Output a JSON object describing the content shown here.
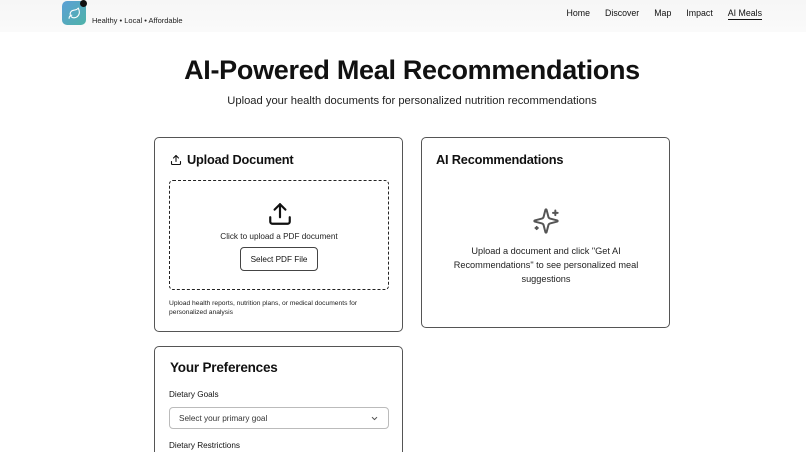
{
  "header": {
    "tagline": "Healthy • Local • Affordable",
    "nav": [
      {
        "label": "Home"
      },
      {
        "label": "Discover"
      },
      {
        "label": "Map"
      },
      {
        "label": "Impact"
      },
      {
        "label": "AI Meals",
        "active": true
      }
    ]
  },
  "hero": {
    "title": "AI-Powered Meal Recommendations",
    "subtitle": "Upload your health documents for personalized nutrition recommendations"
  },
  "upload": {
    "title": "Upload Document",
    "prompt": "Click to upload a PDF document",
    "button_label": "Select PDF File",
    "helper": "Upload health reports, nutrition plans, or medical documents for personalized analysis"
  },
  "ai": {
    "title": "AI Recommendations",
    "empty_message": "Upload a document and click \"Get AI Recommendations\" to see personalized meal suggestions"
  },
  "preferences": {
    "title": "Your Preferences",
    "dietary_goals_label": "Dietary Goals",
    "dietary_goals_value": "Select your primary goal",
    "dietary_restrictions_label": "Dietary Restrictions"
  },
  "colors": {
    "logo_gradient_start": "#5b9fd6",
    "logo_gradient_end": "#4fb3a8",
    "text": "#111111",
    "border": "#555555"
  },
  "icons": {
    "logo": "leaf-icon",
    "upload_header": "upload-icon",
    "dropzone": "upload-icon",
    "ai": "sparkles-icon",
    "select": "chevron-down-icon"
  }
}
